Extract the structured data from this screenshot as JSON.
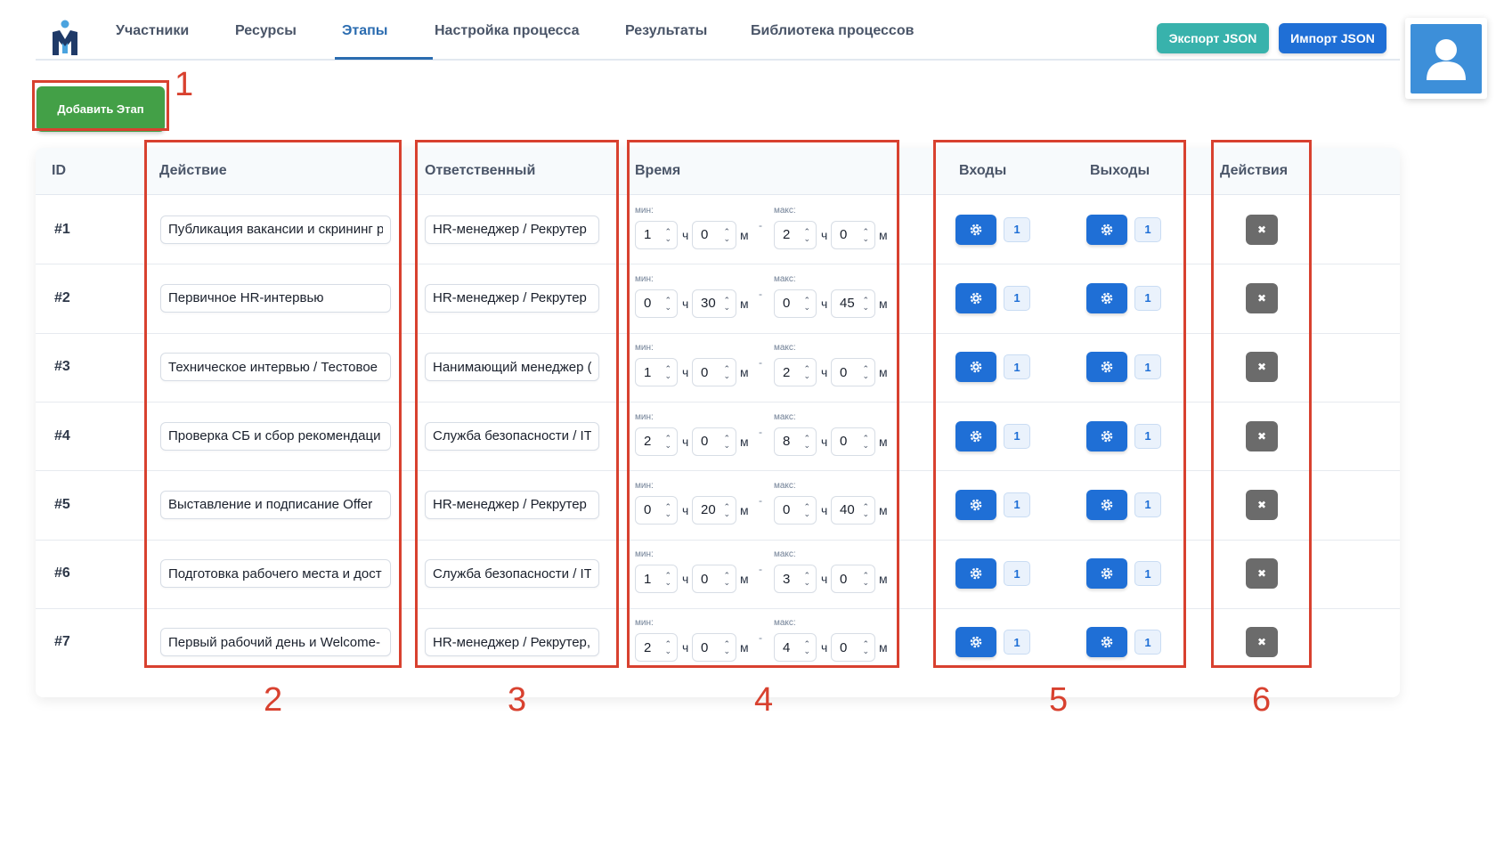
{
  "nav": {
    "tabs": [
      {
        "label": "Участники"
      },
      {
        "label": "Ресурсы"
      },
      {
        "label": "Этапы"
      },
      {
        "label": "Настройка процесса"
      },
      {
        "label": "Результаты"
      },
      {
        "label": "Библиотека процессов"
      }
    ],
    "active_tab": "Этапы",
    "export_label": "Экспорт JSON",
    "import_label": "Импорт JSON"
  },
  "add_stage_label": "Добавить Этап",
  "table": {
    "headers": {
      "id": "ID",
      "action": "Действие",
      "responsible": "Ответственный",
      "time": "Время",
      "inputs": "Входы",
      "outputs": "Выходы",
      "actions": "Действия"
    },
    "min_label": "мин:",
    "max_label": "макс:",
    "hours_unit": "ч",
    "minutes_unit": "м",
    "range_dash": "-",
    "rows": [
      {
        "id": "#1",
        "action": "Публикация вакансии и скрининг р",
        "responsible": "HR-менеджер / Рекрутер",
        "min_h": "1",
        "min_m": "0",
        "max_h": "2",
        "max_m": "0",
        "inputs": "1",
        "outputs": "1"
      },
      {
        "id": "#2",
        "action": "Первичное HR-интервью",
        "responsible": "HR-менеджер / Рекрутер",
        "min_h": "0",
        "min_m": "30",
        "max_h": "0",
        "max_m": "45",
        "inputs": "1",
        "outputs": "1"
      },
      {
        "id": "#3",
        "action": "Техническое интервью / Тестовое",
        "responsible": "Нанимающий менеджер (",
        "min_h": "1",
        "min_m": "0",
        "max_h": "2",
        "max_m": "0",
        "inputs": "1",
        "outputs": "1"
      },
      {
        "id": "#4",
        "action": "Проверка СБ и сбор рекомендаци",
        "responsible": "Служба безопасности / IT",
        "min_h": "2",
        "min_m": "0",
        "max_h": "8",
        "max_m": "0",
        "inputs": "1",
        "outputs": "1"
      },
      {
        "id": "#5",
        "action": "Выставление и подписание Offer",
        "responsible": "HR-менеджер / Рекрутер",
        "min_h": "0",
        "min_m": "20",
        "max_h": "0",
        "max_m": "40",
        "inputs": "1",
        "outputs": "1"
      },
      {
        "id": "#6",
        "action": "Подготовка рабочего места и дост",
        "responsible": "Служба безопасности / IT",
        "min_h": "1",
        "min_m": "0",
        "max_h": "3",
        "max_m": "0",
        "inputs": "1",
        "outputs": "1"
      },
      {
        "id": "#7",
        "action": "Первый рабочий день и Welcome-",
        "responsible": "HR-менеджер / Рекрутер,",
        "min_h": "2",
        "min_m": "0",
        "max_h": "4",
        "max_m": "0",
        "inputs": "1",
        "outputs": "1"
      }
    ]
  },
  "annotations": [
    "1",
    "2",
    "3",
    "4",
    "5",
    "6"
  ],
  "icons": {
    "gear": "gear-icon",
    "delete": "close-icon",
    "avatar": "user-icon",
    "logo": "app-logo"
  },
  "colors": {
    "primary": "#1f6fd6",
    "success": "#43a047",
    "teal": "#38b2ac",
    "annotation": "#d8412f",
    "delete": "#6b6b6b"
  }
}
